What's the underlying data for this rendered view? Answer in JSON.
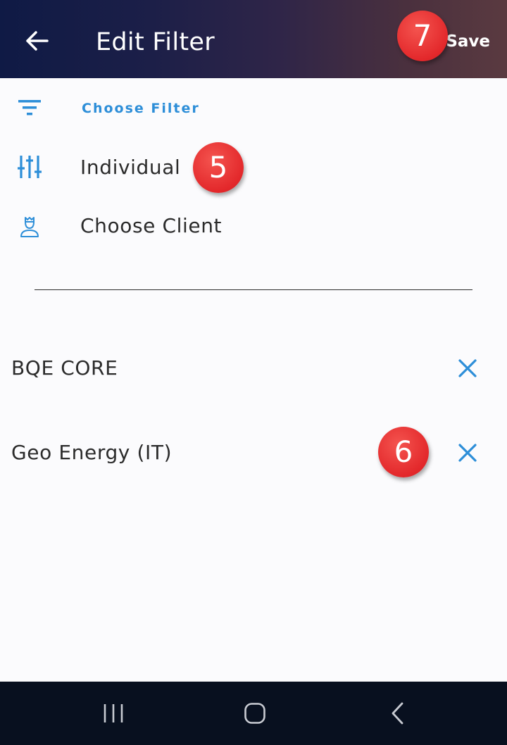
{
  "appbar": {
    "title": "Edit Filter",
    "save_label": "Save",
    "back_icon": "arrow-left-icon"
  },
  "filter": {
    "choose_filter_label": "Choose Filter",
    "type_value": "Individual",
    "client_placeholder": "Choose Client"
  },
  "clients": [
    {
      "name": "BQE CORE"
    },
    {
      "name": "Geo Energy (IT)"
    }
  ],
  "badges": {
    "save": "7",
    "filter_type": "5",
    "remove_client": "6"
  },
  "colors": {
    "accent": "#2d8ed8",
    "badge": "#e3282b",
    "text": "#2b2b2b"
  },
  "navbar": {
    "recent_icon": "recent-apps-icon",
    "home_icon": "home-icon",
    "back_icon": "back-chevron-icon"
  }
}
